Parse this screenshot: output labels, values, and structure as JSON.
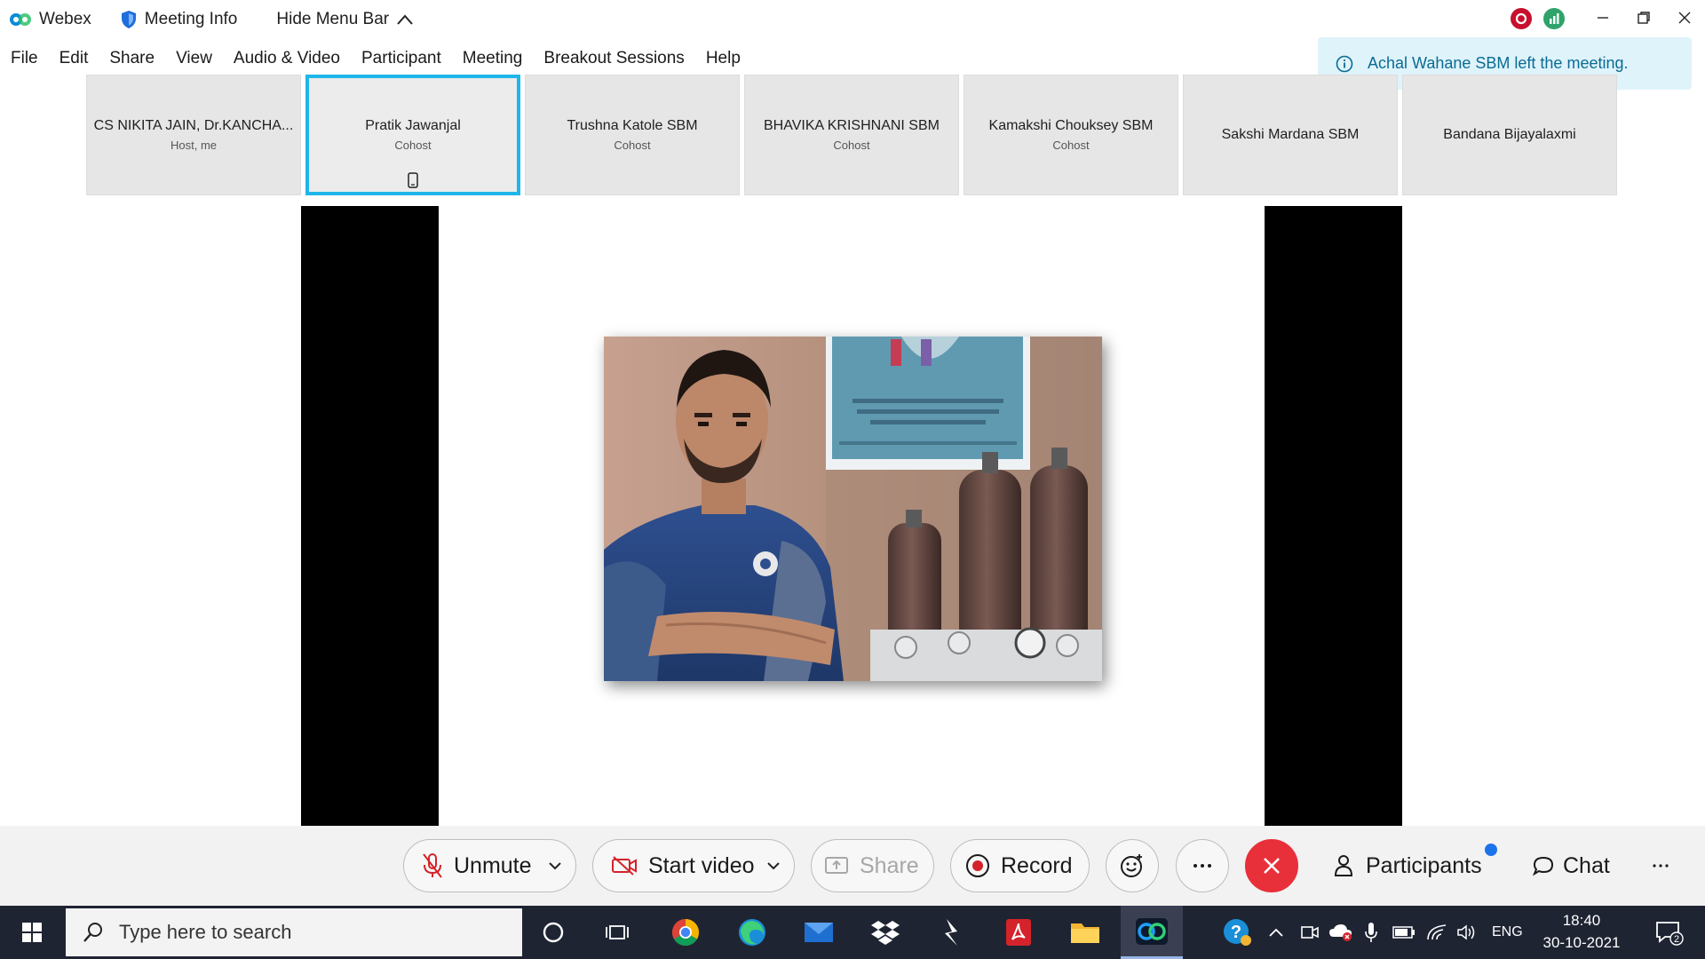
{
  "titlebar": {
    "app_name": "Webex",
    "meeting_info": "Meeting Info",
    "hide_menu_bar": "Hide Menu Bar"
  },
  "menubar": {
    "items": [
      "File",
      "Edit",
      "Share",
      "View",
      "Audio & Video",
      "Participant",
      "Meeting",
      "Breakout Sessions",
      "Help"
    ]
  },
  "toast": {
    "message": "Achal Wahane SBM left the meeting."
  },
  "participants": [
    {
      "name": "CS NIKITA JAIN, Dr.KANCHA...",
      "role": "Host, me"
    },
    {
      "name": "Pratik Jawanjal",
      "role": "Cohost",
      "active": true
    },
    {
      "name": "Trushna Katole SBM",
      "role": "Cohost"
    },
    {
      "name": "BHAVIKA KRISHNANI SBM",
      "role": "Cohost"
    },
    {
      "name": "Kamakshi Chouksey SBM",
      "role": "Cohost"
    },
    {
      "name": "Sakshi Mardana SBM",
      "role": ""
    },
    {
      "name": "Bandana Bijayalaxmi",
      "role": ""
    }
  ],
  "controls": {
    "unmute": "Unmute",
    "start_video": "Start video",
    "share": "Share",
    "record": "Record",
    "participants": "Participants",
    "chat": "Chat"
  },
  "taskbar": {
    "search_placeholder": "Type here to search",
    "language": "ENG",
    "time": "18:40",
    "date": "30-10-2021",
    "notification_count": "2"
  },
  "colors": {
    "accent": "#1fb6ea",
    "leave": "#e8303b",
    "toast_bg": "#dff3fa",
    "taskbar": "#1f2433"
  }
}
